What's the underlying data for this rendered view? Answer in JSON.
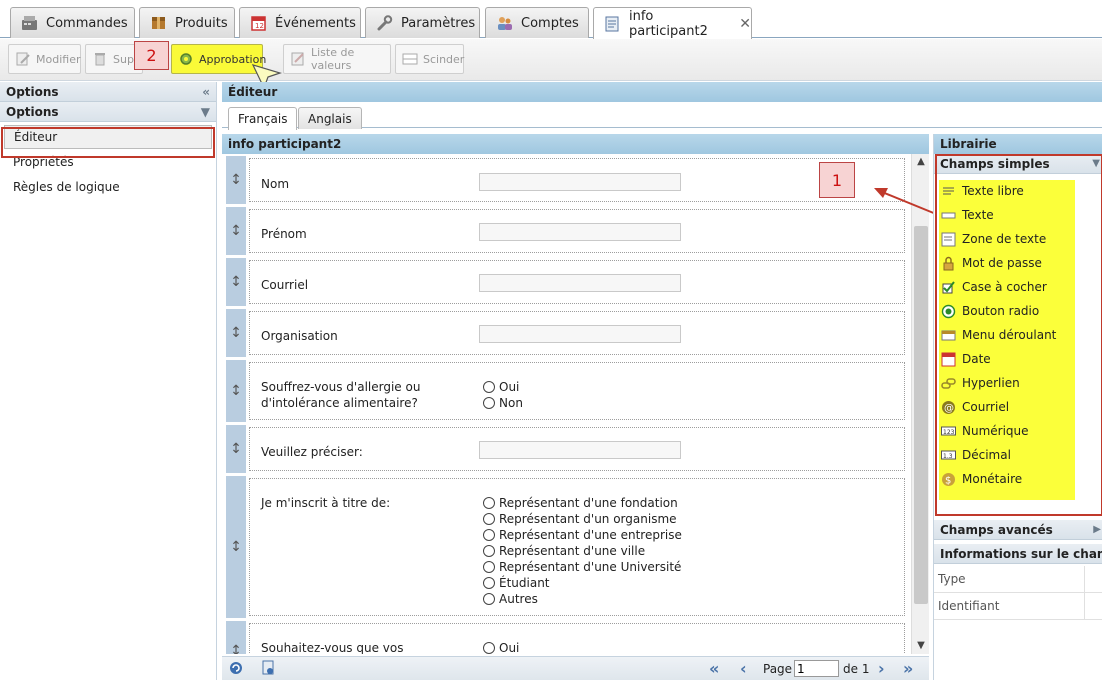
{
  "top_tabs": [
    {
      "label": "Commandes",
      "icon": "register-icon"
    },
    {
      "label": "Produits",
      "icon": "box-icon"
    },
    {
      "label": "Événements",
      "icon": "calendar-icon"
    },
    {
      "label": "Paramètres",
      "icon": "wrench-icon"
    },
    {
      "label": "Comptes",
      "icon": "users-icon"
    },
    {
      "label": "info participant2",
      "icon": "form-icon",
      "close": "✕"
    }
  ],
  "toolbar": {
    "modify_label": "Modifier",
    "delete_label": "Supp",
    "approval_label": "Approbation",
    "values_list_label": "Liste de valeurs",
    "split_label": "Scinder",
    "badge_2": "2"
  },
  "left": {
    "header1": "Options",
    "header2": "Options",
    "items": [
      "Éditeur",
      "Propriétés",
      "Règles de logique"
    ]
  },
  "editor": {
    "title": "Éditeur",
    "lang_tabs": [
      "Français",
      "Anglais"
    ],
    "form_title": "info participant2",
    "handle_glyph": "↕",
    "fields": {
      "nom": "Nom",
      "prenom": "Prénom",
      "courriel": "Courriel",
      "organisation": "Organisation",
      "allergie_line1": "Souffrez-vous d'allergie ou",
      "allergie_line2": "d'intolérance alimentaire?",
      "allergie_opts": [
        "Oui",
        "Non"
      ],
      "preciser": "Veuillez préciser:",
      "inscrit": "Je m'inscrit à titre de:",
      "inscrit_opts": [
        "Représentant d'une fondation",
        "Représentant d'un organisme",
        "Représentant d'une entreprise",
        "Représentant d'une ville",
        "Représentant d'une Université",
        "Étudiant",
        "Autres"
      ],
      "souhaitez": "Souhaitez-vous que vos",
      "souhaitez_opts": [
        "Oui"
      ]
    },
    "badge_1": "1"
  },
  "pager": {
    "page_label": "Page",
    "page_value": "1",
    "of_label": "de 1"
  },
  "library": {
    "title": "Librairie",
    "simple_header": "Champs simples",
    "simple_items": [
      {
        "label": "Texte libre",
        "icon": "free-text-icon"
      },
      {
        "label": "Texte",
        "icon": "text-icon"
      },
      {
        "label": "Zone de texte",
        "icon": "textarea-icon"
      },
      {
        "label": "Mot de passe",
        "icon": "lock-icon"
      },
      {
        "label": "Case à cocher",
        "icon": "checkbox-icon"
      },
      {
        "label": "Bouton radio",
        "icon": "radio-icon"
      },
      {
        "label": "Menu déroulant",
        "icon": "dropdown-icon"
      },
      {
        "label": "Date",
        "icon": "date-icon"
      },
      {
        "label": "Hyperlien",
        "icon": "link-icon"
      },
      {
        "label": "Courriel",
        "icon": "at-icon"
      },
      {
        "label": "Numérique",
        "icon": "numeric-icon"
      },
      {
        "label": "Décimal",
        "icon": "decimal-icon"
      },
      {
        "label": "Monétaire",
        "icon": "money-icon"
      }
    ],
    "advanced_header": "Champs avancés",
    "info_header": "Informations sur le champ",
    "info_rows": [
      "Type",
      "Identifiant"
    ]
  },
  "colors": {
    "highlight": "#fbff3a",
    "annotation_red": "#c0392b",
    "header_blue": "#a9cde4"
  }
}
